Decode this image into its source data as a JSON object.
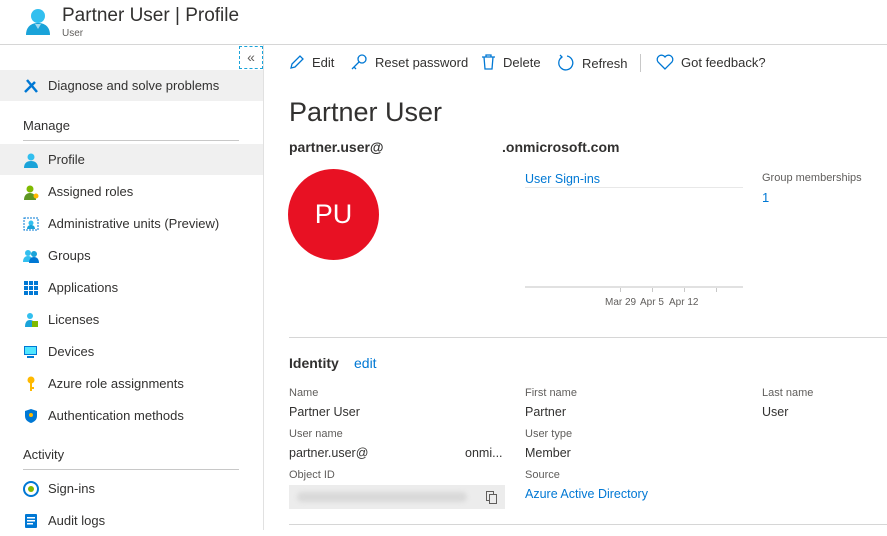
{
  "header": {
    "title": "Partner User | Profile",
    "subtitle": "User"
  },
  "sidebar": {
    "collapse_icon": "«",
    "diagnose": "Diagnose and solve problems",
    "manage_heading": "Manage",
    "manage_items": [
      {
        "label": "Profile",
        "icon": "person-icon",
        "selected": true
      },
      {
        "label": "Assigned roles",
        "icon": "assigned-roles-icon"
      },
      {
        "label": "Administrative units (Preview)",
        "icon": "admin-units-icon"
      },
      {
        "label": "Groups",
        "icon": "groups-icon"
      },
      {
        "label": "Applications",
        "icon": "applications-grid-icon"
      },
      {
        "label": "Licenses",
        "icon": "licenses-icon"
      },
      {
        "label": "Devices",
        "icon": "devices-icon"
      },
      {
        "label": "Azure role assignments",
        "icon": "key-icon"
      },
      {
        "label": "Authentication methods",
        "icon": "shield-icon"
      }
    ],
    "activity_heading": "Activity",
    "activity_items": [
      {
        "label": "Sign-ins",
        "icon": "sign-ins-icon"
      },
      {
        "label": "Audit logs",
        "icon": "audit-logs-icon"
      }
    ]
  },
  "toolbar": {
    "edit": "Edit",
    "reset_password": "Reset password",
    "delete": "Delete",
    "refresh": "Refresh",
    "feedback": "Got feedback?"
  },
  "profile": {
    "name": "Partner User",
    "email_prefix": "partner.user@",
    "email_suffix": ".onmicrosoft.com",
    "initials": "PU",
    "avatar_color": "#e81123",
    "signins_title": "User Sign-ins",
    "chart_ticks": [
      "Mar 29",
      "Apr 5",
      "Apr 12"
    ],
    "group_label": "Group memberships",
    "group_count": "1"
  },
  "identity": {
    "title": "Identity",
    "edit": "edit",
    "name_label": "Name",
    "name": "Partner User",
    "first_label": "First name",
    "first": "Partner",
    "last_label": "Last name",
    "last": "User",
    "username_label": "User name",
    "username_prefix": "partner.user@",
    "username_suffix": "onmi...",
    "usertype_label": "User type",
    "usertype": "Member",
    "objectid_label": "Object ID",
    "source_label": "Source",
    "source": "Azure Active Directory"
  }
}
